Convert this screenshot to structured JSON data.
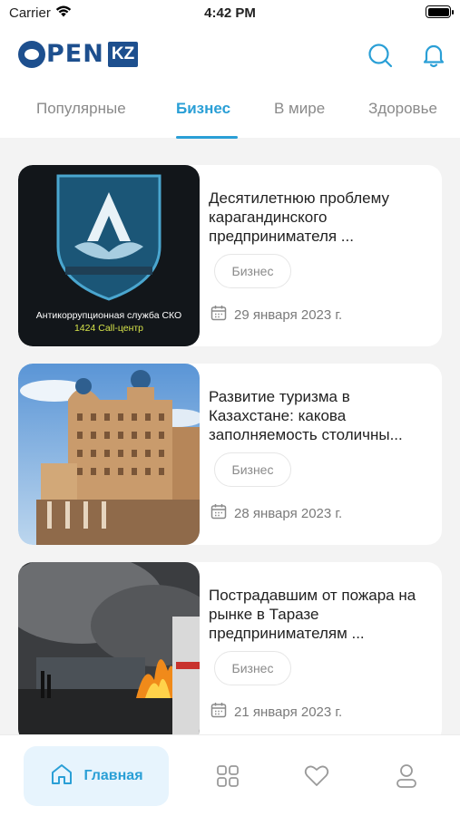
{
  "status": {
    "carrier": "Carrier",
    "time": "4:42 PM"
  },
  "header": {
    "logo_main": "PEN",
    "logo_kz": "KZ"
  },
  "tabs": [
    {
      "label": "Популярные"
    },
    {
      "label": "Бизнес"
    },
    {
      "label": "В мире"
    },
    {
      "label": "Здоровье"
    }
  ],
  "articles": [
    {
      "title": "Десятилетнюю проблему карагандинского предпринимателя ...",
      "tag": "Бизнес",
      "date": "29 января 2023 г.",
      "image_caption_1": "Антикоррупционная служба СКО",
      "image_caption_2": "1424 Call-центр"
    },
    {
      "title": "Развитие туризма в Казахстане: какова заполняемость столичны...",
      "tag": "Бизнес",
      "date": "28 января 2023 г."
    },
    {
      "title": "Пострадавшим от пожара на рынке в Таразе предпринимателям ...",
      "tag": "Бизнес",
      "date": "21 января 2023 г."
    }
  ],
  "bottom_nav": {
    "home_label": "Главная"
  },
  "colors": {
    "accent": "#2a9fd6",
    "brand": "#1d4f8e",
    "background": "#f3f3f3"
  }
}
